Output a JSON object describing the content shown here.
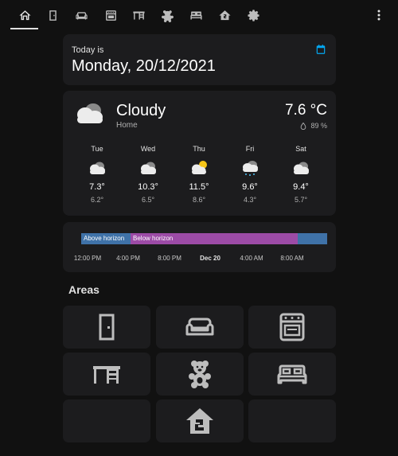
{
  "topbar": {
    "tabs": [
      {
        "icon": "home-icon"
      },
      {
        "icon": "door-icon"
      },
      {
        "icon": "sofa-icon"
      },
      {
        "icon": "stove-icon"
      },
      {
        "icon": "desk-icon"
      },
      {
        "icon": "teddy-bear-icon"
      },
      {
        "icon": "bed-icon"
      },
      {
        "icon": "home-floor-2-icon"
      },
      {
        "icon": "gear-icon"
      }
    ],
    "menu_icon": "dots-vertical-icon"
  },
  "date_card": {
    "label": "Today is",
    "value": "Monday, 20/12/2021",
    "icon": "calendar-icon"
  },
  "weather": {
    "condition": "Cloudy",
    "location": "Home",
    "temperature": "7.6 °C",
    "humidity": "89 %",
    "forecast": [
      {
        "day": "Tue",
        "icon": "cloudy-icon",
        "high": "7.3°",
        "low": "6.2°"
      },
      {
        "day": "Wed",
        "icon": "cloudy-icon",
        "high": "10.3°",
        "low": "6.5°"
      },
      {
        "day": "Thu",
        "icon": "partly-cloudy-icon",
        "high": "11.5°",
        "low": "8.6°"
      },
      {
        "day": "Fri",
        "icon": "snowy-rainy-icon",
        "high": "9.6°",
        "low": "4.3°"
      },
      {
        "day": "Sat",
        "icon": "cloudy-icon",
        "high": "9.4°",
        "low": "5.7°"
      }
    ]
  },
  "sun": {
    "segments": [
      {
        "label": "Above horizon",
        "color": "#3f72a8"
      },
      {
        "label": "Below horizon",
        "color": "#9c4ba6"
      },
      {
        "label": "",
        "color": "#3f72a8"
      }
    ],
    "ticks": [
      "12:00 PM",
      "4:00 PM",
      "8:00 PM",
      "Dec 20",
      "4:00 AM",
      "8:00 AM"
    ]
  },
  "areas": {
    "title": "Areas",
    "tiles": [
      {
        "icon": "door-icon"
      },
      {
        "icon": "sofa-icon"
      },
      {
        "icon": "stove-icon"
      },
      {
        "icon": "desk-icon"
      },
      {
        "icon": "teddy-bear-icon"
      },
      {
        "icon": "bed-icon"
      },
      {
        "icon": ""
      },
      {
        "icon": "home-floor-2-icon"
      },
      {
        "icon": ""
      }
    ]
  },
  "colors": {
    "background": "#111111",
    "card": "#1c1c1e",
    "accent": "#03a9f4",
    "icon_gray": "#bdbdbd"
  }
}
